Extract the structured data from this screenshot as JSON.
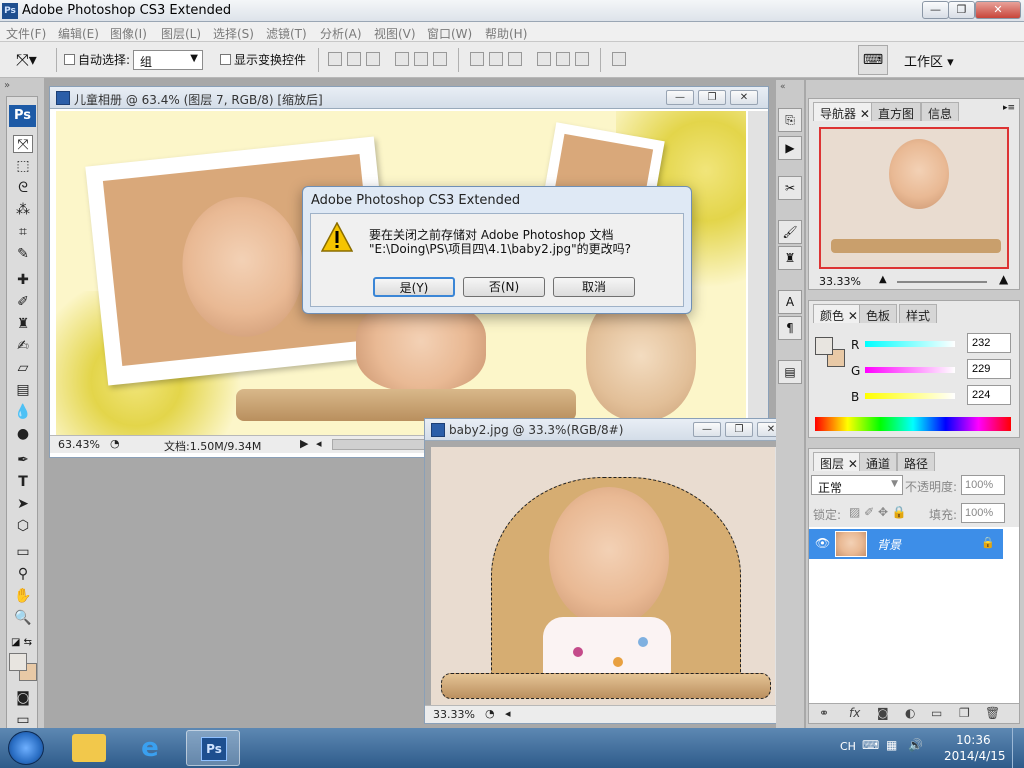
{
  "app": {
    "title": "Adobe Photoshop CS3 Extended",
    "logo": "Ps"
  },
  "window_controls": {
    "minimize": "—",
    "restore": "❐",
    "close": "✕"
  },
  "menu": [
    "文件(F)",
    "编辑(E)",
    "图像(I)",
    "图层(L)",
    "选择(S)",
    "滤镜(T)",
    "分析(A)",
    "视图(V)",
    "窗口(W)",
    "帮助(H)"
  ],
  "options": {
    "auto_select_label": "自动选择:",
    "auto_select_value": "组",
    "show_transform_label": "显示变换控件",
    "workspace_label": "工作区 ▾"
  },
  "doc1": {
    "title": "儿童相册 @ 63.4% (图层 7, RGB/8) [缩放后]",
    "zoom": "63.43%",
    "doc_size": "文档:1.50M/9.34M"
  },
  "doc2": {
    "title": "baby2.jpg @ 33.3%(RGB/8#)",
    "zoom": "33.33%"
  },
  "dialog": {
    "title": "Adobe Photoshop CS3 Extended",
    "line1": "要在关闭之前存储对 Adobe Photoshop 文档",
    "line2": "\"E:\\Doing\\PS\\项目四\\4.1\\baby2.jpg\"的更改吗?",
    "yes": "是(Y)",
    "no": "否(N)",
    "cancel": "取消"
  },
  "navigator": {
    "tabs": [
      "导航器",
      "直方图",
      "信息"
    ],
    "zoom": "33.33%"
  },
  "color": {
    "tabs": [
      "颜色",
      "色板",
      "样式"
    ],
    "R": "232",
    "G": "229",
    "B": "224",
    "swatch": "#e8c9a6"
  },
  "layers": {
    "tabs": [
      "图层",
      "通道",
      "路径"
    ],
    "blend": "正常",
    "opacity_label": "不透明度:",
    "opacity": "100%",
    "lock_label": "锁定:",
    "fill_label": "填充:",
    "fill": "100%",
    "layer_name": "背景"
  },
  "taskbar": {
    "lang": "CH",
    "time": "10:36",
    "date": "2014/4/15"
  }
}
